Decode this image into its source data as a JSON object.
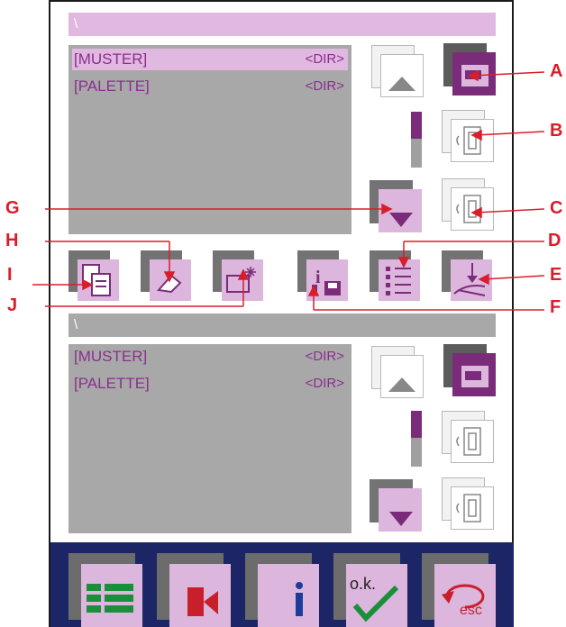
{
  "top_panel": {
    "path": "\\",
    "items": [
      {
        "name": "[MUSTER]",
        "type": "<DIR>",
        "selected": true
      },
      {
        "name": "[PALETTE]",
        "type": "<DIR>",
        "selected": false
      }
    ],
    "scroll_position": 0.0
  },
  "bottom_panel": {
    "path": "\\",
    "items": [
      {
        "name": "[MUSTER]",
        "type": "<DIR>"
      },
      {
        "name": "[PALETTE]",
        "type": "<DIR>"
      }
    ],
    "scroll_position": 0.0
  },
  "callouts": {
    "a": "A",
    "b": "B",
    "c": "C",
    "d": "D",
    "e": "E",
    "f": "F",
    "g": "G",
    "h": "H",
    "i": "I",
    "j": "J"
  },
  "bottom_toolbar": {
    "ok_label": "o.k.",
    "esc_label": "esc"
  },
  "colors": {
    "accent_purple": "#7a2c7a",
    "button_pink": "#dcb6dc",
    "path_bar_selected": "#e0b8e0",
    "panel_gray": "#a8a8a8",
    "toolbar_navy": "#1c2566",
    "callout_red": "#d81e2b"
  }
}
